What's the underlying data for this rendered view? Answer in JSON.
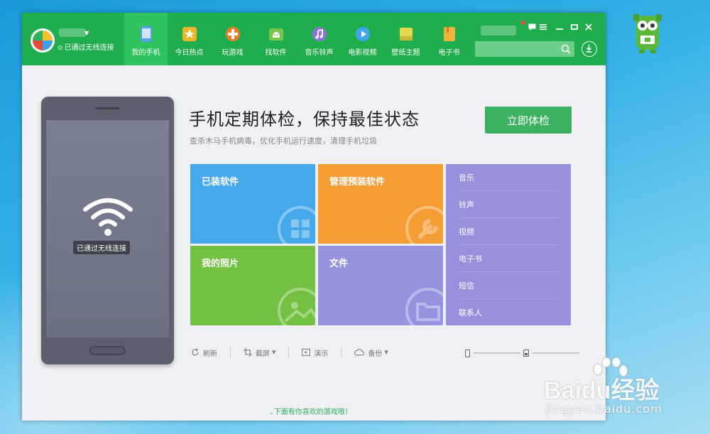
{
  "app": {
    "connection_status": "已通过无线连接"
  },
  "nav": {
    "items": [
      {
        "label": "我的手机",
        "icon": "phone-icon",
        "color": "#5aa2e8"
      },
      {
        "label": "今日热点",
        "icon": "star-icon",
        "color": "#f0b429"
      },
      {
        "label": "玩游戏",
        "icon": "gamepad-icon",
        "color": "#ef7d2c"
      },
      {
        "label": "找软件",
        "icon": "android-icon",
        "color": "#7bc34a"
      },
      {
        "label": "音乐铃声",
        "icon": "music-icon",
        "color": "#8b74d8"
      },
      {
        "label": "电影视频",
        "icon": "play-icon",
        "color": "#42a5e8"
      },
      {
        "label": "壁纸主题",
        "icon": "wallpaper-icon",
        "color": "#e5d84f"
      },
      {
        "label": "电子书",
        "icon": "book-icon",
        "color": "#f2b23a"
      }
    ]
  },
  "phone": {
    "status": "已通过无线连接"
  },
  "hero": {
    "title": "手机定期体检，保持最佳状态",
    "subtitle": "查杀木马手机病毒，优化手机运行速度，清理手机垃圾",
    "check_button": "立即体检"
  },
  "tiles": [
    {
      "label": "已装软件",
      "icon": "apps-icon",
      "color": "#46a9eb"
    },
    {
      "label": "管理预装软件",
      "icon": "wrench-icon",
      "color": "#f59c34"
    },
    {
      "label": "我的照片",
      "icon": "photo-icon",
      "color": "#74c043"
    },
    {
      "label": "文件",
      "icon": "folder-icon",
      "color": "#9592e0"
    }
  ],
  "list_tile": {
    "items": [
      "音乐",
      "铃声",
      "视频",
      "电子书",
      "短信",
      "联系人"
    ]
  },
  "toolbar": {
    "refresh": "刷新",
    "screenshot": "截屏",
    "demo": "演示",
    "backup": "备份"
  },
  "footer": {
    "games_link": "下面有你喜欢的游戏哦！"
  },
  "watermark": {
    "brand": "Baidu经验",
    "url": "jingyan.baidu.com"
  },
  "colors": {
    "topbar": "#20ad4d",
    "active_tab": "#2ec35e",
    "primary_button": "#3bb161"
  }
}
